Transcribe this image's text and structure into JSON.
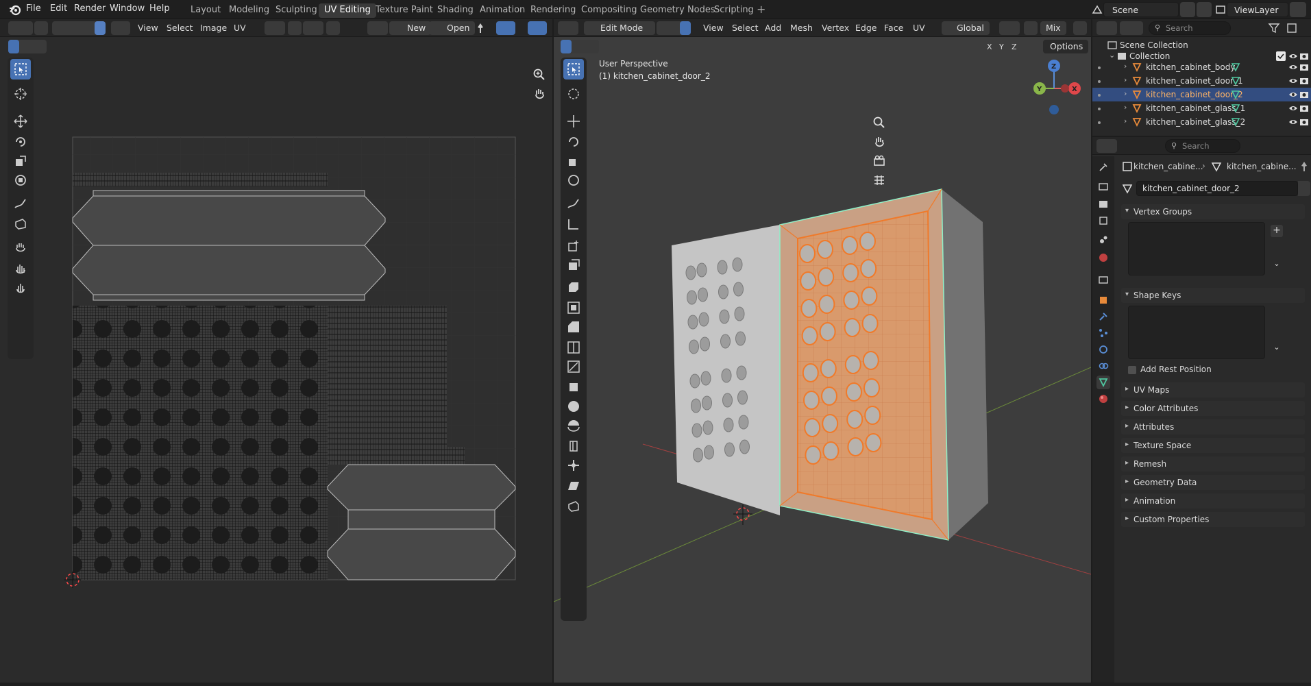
{
  "topbar": {
    "menus": [
      "File",
      "Edit",
      "Render",
      "Window",
      "Help"
    ],
    "workspaces": [
      "Layout",
      "Modeling",
      "Sculpting",
      "UV Editing",
      "Texture Paint",
      "Shading",
      "Animation",
      "Rendering",
      "Compositing",
      "Geometry Nodes",
      "Scripting"
    ],
    "active_workspace": "UV Editing",
    "add_workspace": "+",
    "scene": "Scene",
    "view_layer": "ViewLayer"
  },
  "uv_editor": {
    "menus": [
      "View",
      "Select",
      "Image",
      "UV"
    ],
    "new_label": "New",
    "open_label": "Open"
  },
  "viewport": {
    "mode": "Edit Mode",
    "menus": [
      "View",
      "Select",
      "Add",
      "Mesh",
      "Vertex",
      "Edge",
      "Face",
      "UV"
    ],
    "orientation": "Global",
    "proportional": "Mix",
    "options_label": "Options",
    "axes": [
      "X",
      "Y",
      "Z"
    ],
    "overlay_title": "User Perspective",
    "overlay_object": "(1) kitchen_cabinet_door_2",
    "gizmo": {
      "x": "X",
      "y": "Y",
      "z": "Z"
    }
  },
  "outliner": {
    "search_placeholder": "Search",
    "scene_collection": "Scene Collection",
    "collection": "Collection",
    "objects": [
      {
        "name": "kitchen_cabinet_body",
        "selected": false
      },
      {
        "name": "kitchen_cabinet_door_1",
        "selected": false
      },
      {
        "name": "kitchen_cabinet_door_2",
        "selected": true
      },
      {
        "name": "kitchen_cabinet_glass_1",
        "selected": false
      },
      {
        "name": "kitchen_cabinet_glass_2",
        "selected": false
      }
    ]
  },
  "properties": {
    "search_placeholder": "Search",
    "breadcrumb_object": "kitchen_cabine...",
    "breadcrumb_mesh": "kitchen_cabine...",
    "mesh_name": "kitchen_cabinet_door_2",
    "sections": {
      "vertex_groups": "Vertex Groups",
      "shape_keys": "Shape Keys",
      "add_rest_position": "Add Rest Position",
      "uv_maps": "UV Maps",
      "color_attributes": "Color Attributes",
      "attributes": "Attributes",
      "texture_space": "Texture Space",
      "remesh": "Remesh",
      "geometry_data": "Geometry Data",
      "animation": "Animation",
      "custom_properties": "Custom Properties"
    }
  },
  "colors": {
    "accent": "#4772b3",
    "selected_orange": "#f07a2a",
    "active_edge": "#8ff0c8",
    "mesh_icon": "#e88a3a",
    "data_icon": "#4fc7a0"
  }
}
